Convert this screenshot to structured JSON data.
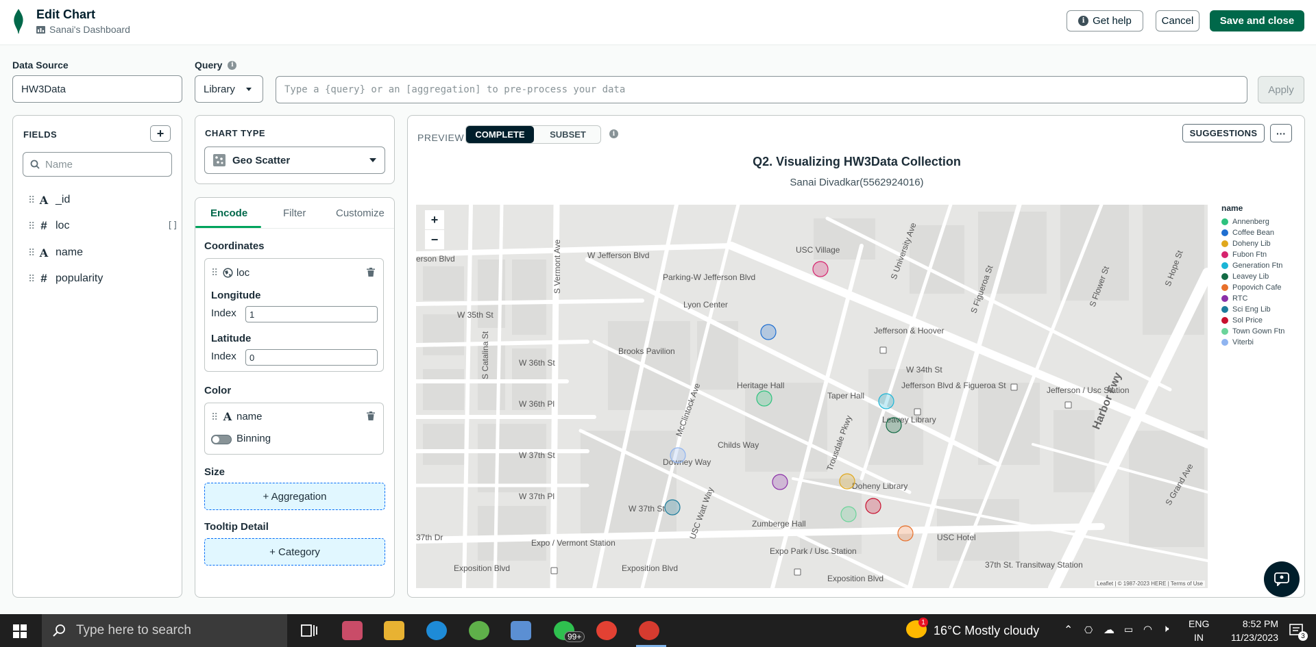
{
  "header": {
    "title": "Edit Chart",
    "dashboard": "Sanai's Dashboard",
    "get_help": "Get help",
    "cancel": "Cancel",
    "save_close": "Save and close"
  },
  "data_source": {
    "label": "Data Source",
    "value": "HW3Data"
  },
  "query": {
    "label": "Query",
    "mode": "Library",
    "placeholder": "Type a {query} or an [aggregation] to pre-process your data",
    "apply": "Apply"
  },
  "fields": {
    "title": "FIELDS",
    "search_placeholder": "Name",
    "items": [
      {
        "type": "A",
        "name": "_id"
      },
      {
        "type": "#",
        "name": "loc",
        "suffix": "[]"
      },
      {
        "type": "A",
        "name": "name"
      },
      {
        "type": "#",
        "name": "popularity"
      }
    ]
  },
  "chart_type": {
    "label": "CHART TYPE",
    "value": "Geo Scatter"
  },
  "encode": {
    "tabs": [
      "Encode",
      "Filter",
      "Customize"
    ],
    "coordinates_label": "Coordinates",
    "coord_field": "loc",
    "longitude_label": "Longitude",
    "longitude_index_label": "Index",
    "longitude_index": "1",
    "latitude_label": "Latitude",
    "latitude_index_label": "Index",
    "latitude_index": "0",
    "color_label": "Color",
    "color_field": "name",
    "binning_label": "Binning",
    "size_label": "Size",
    "size_button": "+ Aggregation",
    "tooltip_label": "Tooltip Detail",
    "tooltip_button": "+ Category"
  },
  "preview": {
    "label": "PREVIEW",
    "seg_complete": "COMPLETE",
    "seg_subset": "SUBSET",
    "suggestions": "SUGGESTIONS",
    "more": "···",
    "chart_title": "Q2. Visualizing HW3Data Collection",
    "chart_subtitle": "Sanai Divadkar(5562924016)",
    "zoom_in": "+",
    "zoom_out": "−",
    "attribution": "Leaflet | © 1987-2023 HERE | Terms of Use"
  },
  "map_labels": {
    "usc_village": "USC Village",
    "w_jefferson_blvd": "W Jefferson Blvd",
    "parking": "Parking-W Jefferson Blvd",
    "lyon_center": "Lyon Center",
    "w_35th_st": "W 35th St",
    "brooks_pavilion": "Brooks Pavilion",
    "w_36th_st": "W 36th St",
    "w_36th_pl": "W 36th Pl",
    "w_37th_st": "W 37th St",
    "w_37th_pl": "W 37th Pl",
    "heritage_hall": "Heritage Hall",
    "taper_hall": "Taper Hall",
    "jefferson_hoover": "Jefferson & Hoover",
    "jefferson_figueroa": "Jefferson Blvd & Figueroa St",
    "leavey_library": "Leavey Library",
    "doheny_library": "Doheny Library",
    "zumberge_hall": "Zumberge Hall",
    "expo_vermont": "Expo / Vermont Station",
    "expo_park": "Expo Park / Usc Station",
    "exposition_blvd": "Exposition Blvd",
    "usc_hotel": "USC Hotel",
    "transitway": "37th St. Transitway Station",
    "harbor_fwy": "Harbor Fwy",
    "jefferson_usc": "Jefferson / Usc Station",
    "w_34th_st": "W 34th St",
    "s_figueroa_st": "S Figueroa St",
    "s_vermont_ave": "S Vermont Ave",
    "s_catalina_st": "S Catalina St",
    "mcclintock_ave": "McClintock Ave",
    "childs_way": "Childs Way",
    "downey_way": "Downey Way",
    "trousdale_pkwy": "Trousdale Pkwy",
    "watt_way": "USC Watt Way",
    "w_37th_dr": "37th Dr",
    "s_hope_st": "S Hope St",
    "s_flower_st": "S Flower St",
    "s_grand_ave": "S Grand Ave",
    "university_ave": "S University Ave",
    "w_jefferson_left": "erson Blvd"
  },
  "legend": {
    "title": "name",
    "items": [
      {
        "name": "Annenberg",
        "color": "#2ec27e"
      },
      {
        "name": "Coffee Bean",
        "color": "#1f6fd1"
      },
      {
        "name": "Doheny Lib",
        "color": "#e0a81d"
      },
      {
        "name": "Fubon Ftn",
        "color": "#d6246e"
      },
      {
        "name": "Generation Ftn",
        "color": "#1bb5d6"
      },
      {
        "name": "Leavey Lib",
        "color": "#136b45"
      },
      {
        "name": "Popovich Cafe",
        "color": "#e8702a"
      },
      {
        "name": "RTC",
        "color": "#8b2fa8"
      },
      {
        "name": "Sci Eng Lib",
        "color": "#1c7c9c"
      },
      {
        "name": "Sol Price",
        "color": "#c8102e"
      },
      {
        "name": "Town Gown Ftn",
        "color": "#6bd49a"
      },
      {
        "name": "Viterbi",
        "color": "#8fb4f0"
      }
    ]
  },
  "taskbar": {
    "search_placeholder": "Type here to search",
    "weather": "16°C  Mostly cloudy",
    "lang1": "ENG",
    "lang2": "IN",
    "time": "8:52 PM",
    "date": "11/23/2023",
    "notif_count": "3",
    "whatsapp_badge": "99+",
    "weather_badge": "1"
  }
}
